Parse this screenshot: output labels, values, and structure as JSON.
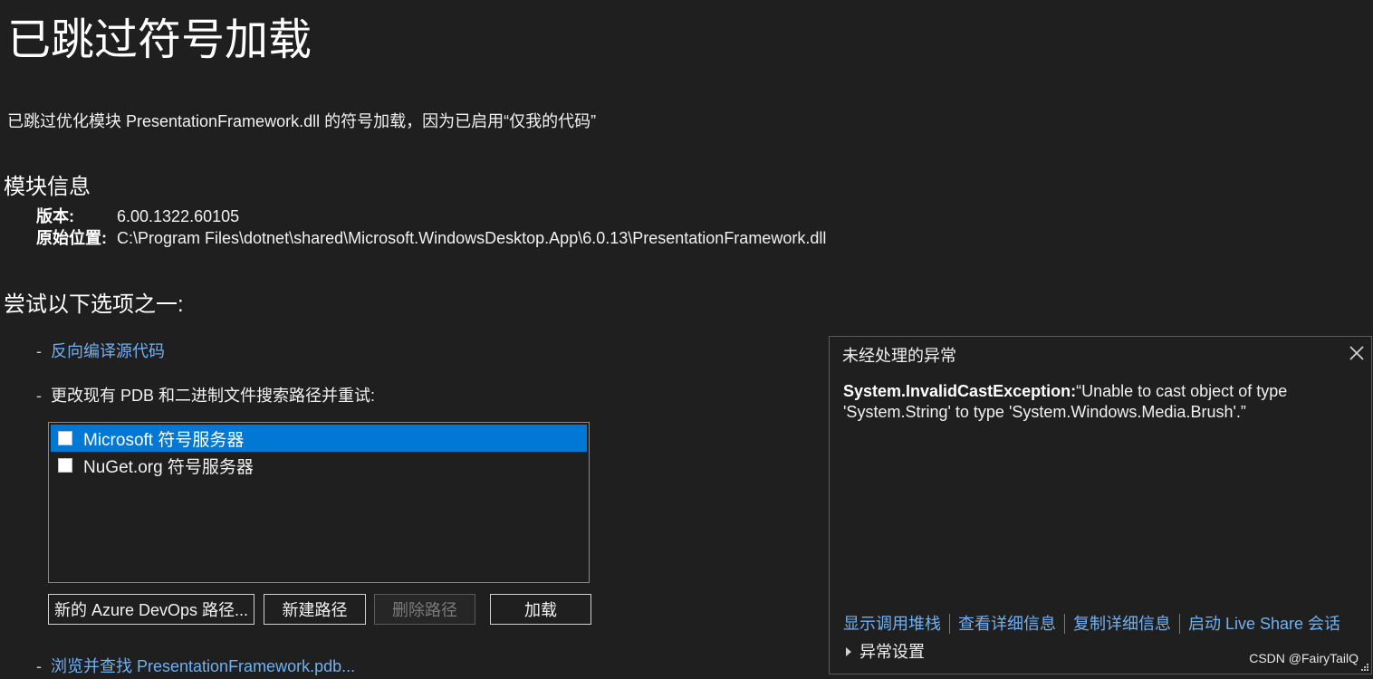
{
  "page_title": "已跳过符号加载",
  "subtitle": "已跳过优化模块 PresentationFramework.dll 的符号加载，因为已启用“仅我的代码”",
  "module_info": {
    "heading": "模块信息",
    "rows": [
      {
        "key": "版本:",
        "value": "6.00.1322.60105"
      },
      {
        "key": "原始位置:",
        "value": "C:\\Program Files\\dotnet\\shared\\Microsoft.WindowsDesktop.App\\6.0.13\\PresentationFramework.dll"
      }
    ]
  },
  "options": {
    "heading": "尝试以下选项之一:",
    "bullet": "-",
    "decompile_link": "反向编译源代码",
    "change_paths_text": "更改现有 PDB 和二进制文件搜索路径并重试:",
    "servers": [
      {
        "label": "Microsoft 符号服务器",
        "checked": false,
        "selected": true
      },
      {
        "label": "NuGet.org 符号服务器",
        "checked": false,
        "selected": false
      }
    ],
    "buttons": {
      "azure": "新的 Azure DevOps 路径...",
      "new_path": "新建路径",
      "delete_path": "删除路径",
      "load": "加载"
    },
    "browse_link": "浏览并查找 PresentationFramework.pdb..."
  },
  "exception_panel": {
    "title": "未经处理的异常",
    "exception_type": "System.InvalidCastException:",
    "exception_message": "“Unable to cast object of type 'System.String' to type 'System.Windows.Media.Brush'.”",
    "links": [
      "显示调用堆栈",
      "查看详细信息",
      "复制详细信息",
      "启动 Live Share 会话"
    ],
    "settings_label": "异常设置",
    "close_icon": "close-icon"
  },
  "watermark": "CSDN @FairyTailQ",
  "colors": {
    "background": "#1f1f1f",
    "link": "#70b0f0",
    "selection": "#0078d4"
  }
}
